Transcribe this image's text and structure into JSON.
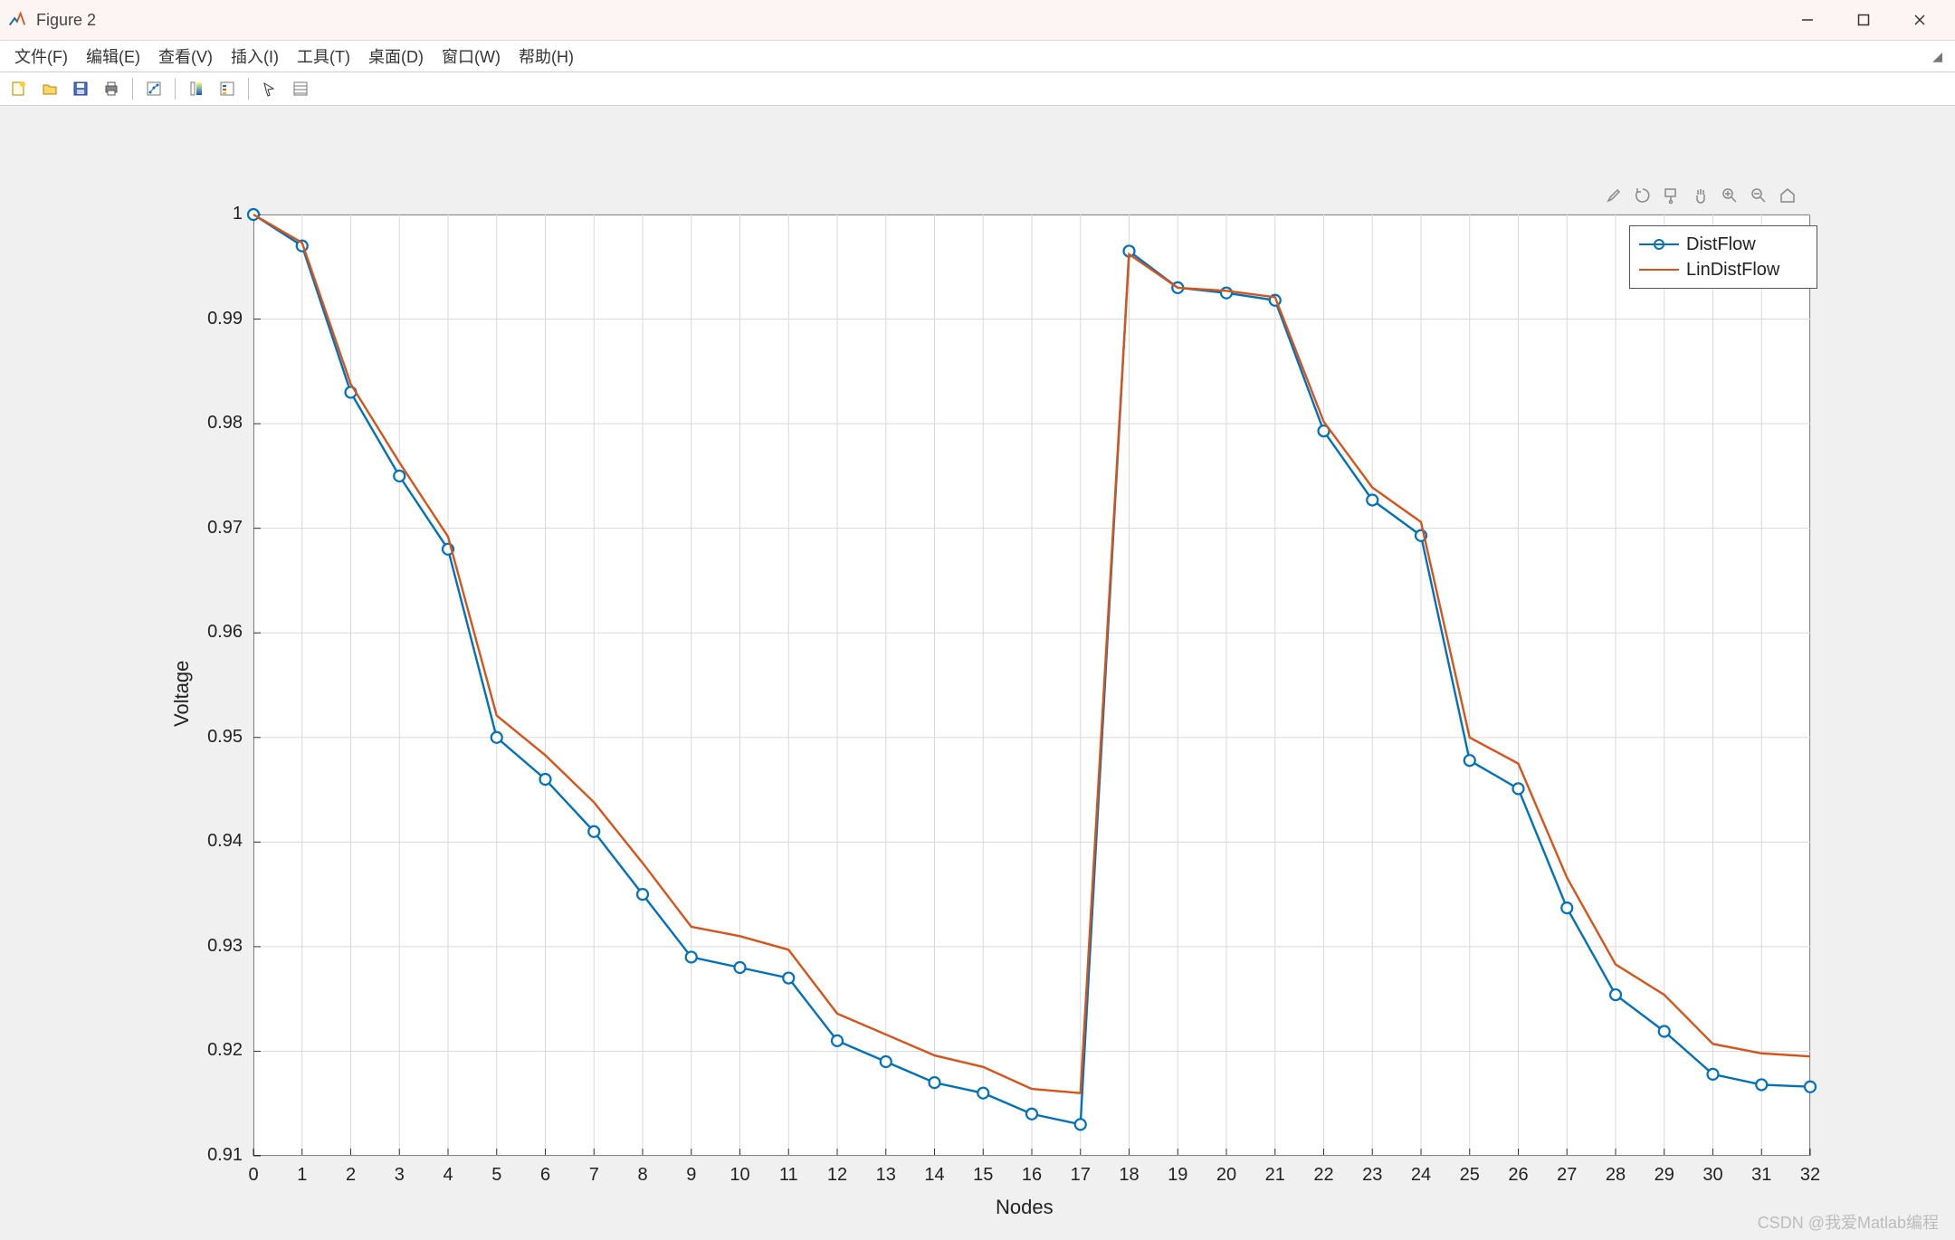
{
  "window": {
    "title": "Figure 2"
  },
  "menus": {
    "file": "文件(F)",
    "edit": "编辑(E)",
    "view": "查看(V)",
    "insert": "插入(I)",
    "tools": "工具(T)",
    "desktop": "桌面(D)",
    "window": "窗口(W)",
    "help": "帮助(H)"
  },
  "toolbar_icons": [
    "new-figure",
    "open",
    "save",
    "print",
    "link",
    "datatip",
    "colorbar",
    "cursor",
    "insert-legend"
  ],
  "axes_toolbar_icons": [
    "brush",
    "rotate",
    "data-cursor",
    "pan",
    "zoom-in",
    "zoom-out",
    "home"
  ],
  "legend": {
    "s1": "DistFlow",
    "s2": "LinDistFlow"
  },
  "axis": {
    "xlabel": "Nodes",
    "ylabel": "Voltage",
    "xticks": [
      0,
      1,
      2,
      3,
      4,
      5,
      6,
      7,
      8,
      9,
      10,
      11,
      12,
      13,
      14,
      15,
      16,
      17,
      18,
      19,
      20,
      21,
      22,
      23,
      24,
      25,
      26,
      27,
      28,
      29,
      30,
      31,
      32
    ],
    "yticks": [
      0.91,
      0.92,
      0.93,
      0.94,
      0.95,
      0.96,
      0.97,
      0.98,
      0.99,
      1
    ]
  },
  "watermark": "CSDN @我爱Matlab编程",
  "chart_data": {
    "type": "line",
    "xlabel": "Nodes",
    "ylabel": "Voltage",
    "xlim": [
      0,
      32
    ],
    "ylim": [
      0.91,
      1.0
    ],
    "grid": true,
    "legend_position": "top-right",
    "x": [
      0,
      1,
      2,
      3,
      4,
      5,
      6,
      7,
      8,
      9,
      10,
      11,
      12,
      13,
      14,
      15,
      16,
      17,
      18,
      19,
      20,
      21,
      22,
      23,
      24,
      25,
      26,
      27,
      28,
      29,
      30,
      31,
      32
    ],
    "series": [
      {
        "name": "DistFlow",
        "color": "#0072bd",
        "marker": "o",
        "values": [
          1.0,
          0.997,
          0.983,
          0.975,
          0.968,
          0.95,
          0.946,
          0.941,
          0.935,
          0.929,
          0.928,
          0.927,
          0.921,
          0.919,
          0.917,
          0.916,
          0.914,
          0.913,
          0.9965,
          0.993,
          0.9925,
          0.9918,
          0.9793,
          0.9727,
          0.9693,
          0.9478,
          0.9451,
          0.9337,
          0.9254,
          0.9219,
          0.9178,
          0.9168,
          0.9166
        ]
      },
      {
        "name": "LinDistFlow",
        "color": "#d95319",
        "marker": "none",
        "values": [
          1.0,
          0.9973,
          0.9838,
          0.9763,
          0.9692,
          0.9521,
          0.9483,
          0.9438,
          0.938,
          0.9319,
          0.931,
          0.9297,
          0.9236,
          0.9216,
          0.9196,
          0.9185,
          0.9164,
          0.916,
          0.9962,
          0.993,
          0.9927,
          0.9921,
          0.9802,
          0.9739,
          0.9706,
          0.95,
          0.9475,
          0.9366,
          0.9283,
          0.9254,
          0.9207,
          0.9198,
          0.9195
        ]
      }
    ]
  }
}
